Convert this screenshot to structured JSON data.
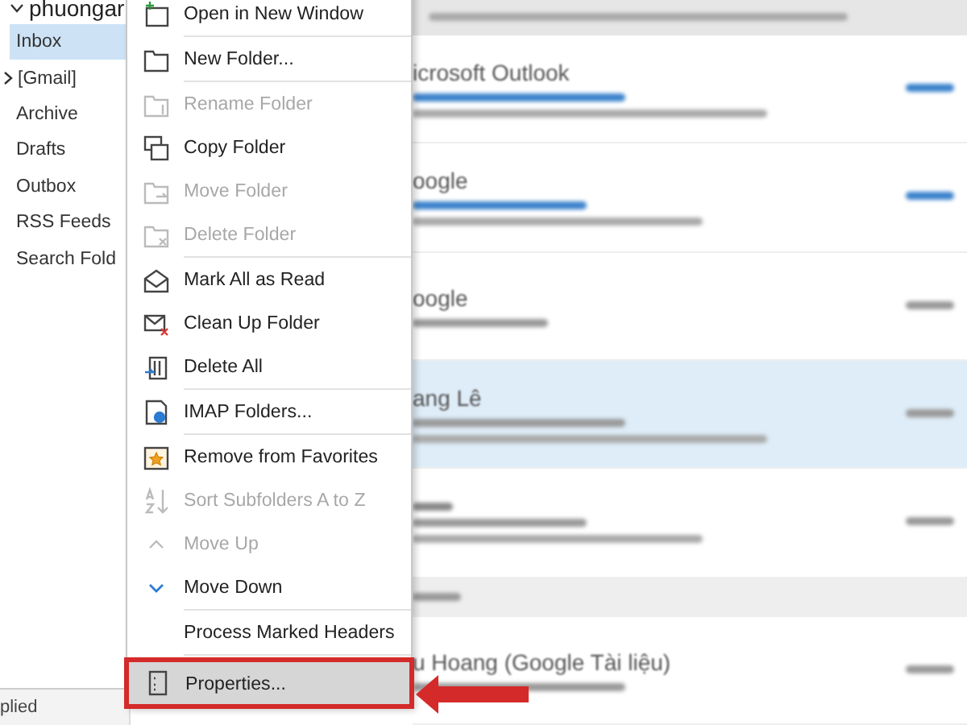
{
  "folder_pane": {
    "account": "phuongar",
    "folders": [
      {
        "label": "Inbox",
        "selected": true,
        "expandable": false
      },
      {
        "label": "[Gmail]",
        "selected": false,
        "expandable": true
      },
      {
        "label": "Archive",
        "selected": false,
        "expandable": false
      },
      {
        "label": "Drafts",
        "selected": false,
        "expandable": false
      },
      {
        "label": "Outbox",
        "selected": false,
        "expandable": false
      },
      {
        "label": "RSS Feeds",
        "selected": false,
        "expandable": false
      },
      {
        "label": "Search Fold",
        "selected": false,
        "expandable": false
      }
    ]
  },
  "status_bar": {
    "text": "plied"
  },
  "messages": [
    {
      "sender": "icrosoft Outlook",
      "selected": false,
      "blue": true
    },
    {
      "sender": "oogle",
      "selected": false,
      "blue": true
    },
    {
      "sender": "oogle",
      "selected": false,
      "blue": false
    },
    {
      "sender": "ang Lê",
      "selected": true,
      "blue": false
    },
    {
      "selected": false,
      "blue": false
    },
    {
      "kind": "group"
    },
    {
      "sender": "u Hoang (Google Tài liệu)",
      "selected": false,
      "blue": false
    }
  ],
  "context_menu": {
    "items": [
      {
        "label": "Open in New Window",
        "kind": "window",
        "disabled": false,
        "separator_after": true
      },
      {
        "label": "New Folder...",
        "kind": "folder",
        "disabled": false,
        "separator_after": true
      },
      {
        "label": "Rename Folder",
        "kind": "rename",
        "disabled": true,
        "separator_after": false
      },
      {
        "label": "Copy Folder",
        "kind": "copy",
        "disabled": false,
        "separator_after": false
      },
      {
        "label": "Move Folder",
        "kind": "move",
        "disabled": true,
        "separator_after": false
      },
      {
        "label": "Delete Folder",
        "kind": "delete",
        "disabled": true,
        "separator_after": true
      },
      {
        "label": "Mark All as Read",
        "kind": "read",
        "disabled": false,
        "separator_after": false
      },
      {
        "label": "Clean Up Folder",
        "kind": "cleanup",
        "disabled": false,
        "separator_after": false
      },
      {
        "label": "Delete All",
        "kind": "trash",
        "disabled": false,
        "separator_after": true
      },
      {
        "label": "IMAP Folders...",
        "kind": "imap",
        "disabled": false,
        "separator_after": true
      },
      {
        "label": "Remove from Favorites",
        "kind": "star",
        "disabled": false,
        "separator_after": false
      },
      {
        "label": "Sort Subfolders A to Z",
        "kind": "sort",
        "disabled": true,
        "separator_after": false
      },
      {
        "label": "Move Up",
        "kind": "up",
        "disabled": true,
        "separator_after": false
      },
      {
        "label": "Move Down",
        "kind": "down",
        "disabled": false,
        "separator_after": true
      },
      {
        "label": "Process Marked Headers",
        "kind": "none",
        "disabled": false,
        "separator_after": true
      },
      {
        "label": "Properties...",
        "kind": "properties",
        "disabled": false,
        "separator_after": false,
        "highlighted": true
      }
    ]
  }
}
